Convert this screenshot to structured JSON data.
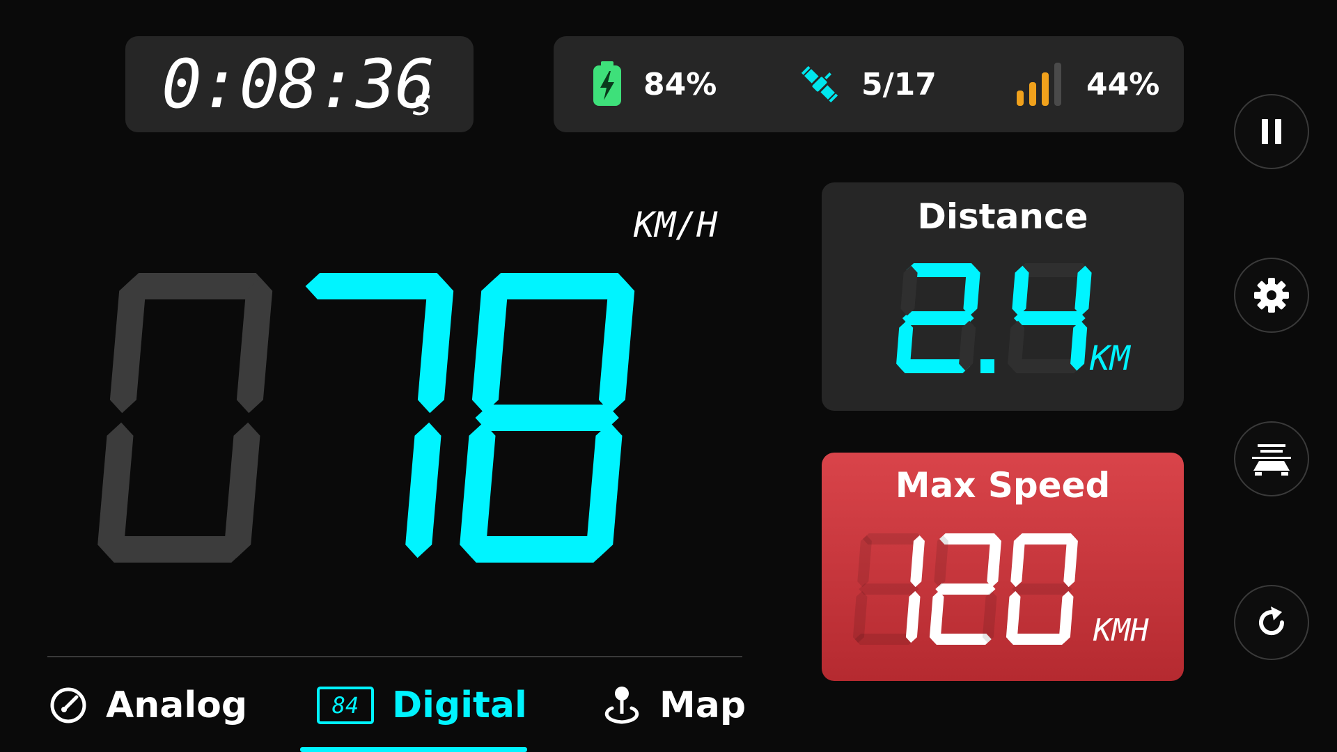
{
  "timer": {
    "value": "0:08:36",
    "unit": "s"
  },
  "status": {
    "battery": {
      "icon": "battery-charging-icon",
      "text": "84%",
      "color": "#3ee07a"
    },
    "satellites": {
      "icon": "satellite-icon",
      "text": "5/17",
      "color": "#00e6ee"
    },
    "signal": {
      "icon": "signal-bars-icon",
      "text": "44%",
      "color": "#f0a11c"
    }
  },
  "speed": {
    "unit": "KM/H",
    "digits": [
      "0",
      "7",
      "8"
    ],
    "active_color": "#00f4ff",
    "inactive_color": "#3c3c3c"
  },
  "distance": {
    "title": "Distance",
    "digits": [
      "2",
      "4"
    ],
    "unit": "KM",
    "color": "#00f4ff"
  },
  "max_speed": {
    "title": "Max Speed",
    "digits": [
      "1",
      "2",
      "0"
    ],
    "unit": "KMH",
    "panel_color": "#c8353b"
  },
  "side_buttons": [
    {
      "name": "pause-button",
      "icon": "pause-icon"
    },
    {
      "name": "settings-button",
      "icon": "gear-icon"
    },
    {
      "name": "hud-mirror-button",
      "icon": "hud-mirror-icon"
    },
    {
      "name": "reset-button",
      "icon": "refresh-icon"
    }
  ],
  "tabs": [
    {
      "label": "Analog",
      "icon": "speedometer-icon",
      "active": false
    },
    {
      "label": "Digital",
      "icon": "digital-display-icon",
      "badge": "84",
      "active": true
    },
    {
      "label": "Map",
      "icon": "map-pin-icon",
      "active": false
    }
  ],
  "colors": {
    "accent": "#00f4ff",
    "background": "#0a0a0a",
    "panel": "#262626"
  }
}
